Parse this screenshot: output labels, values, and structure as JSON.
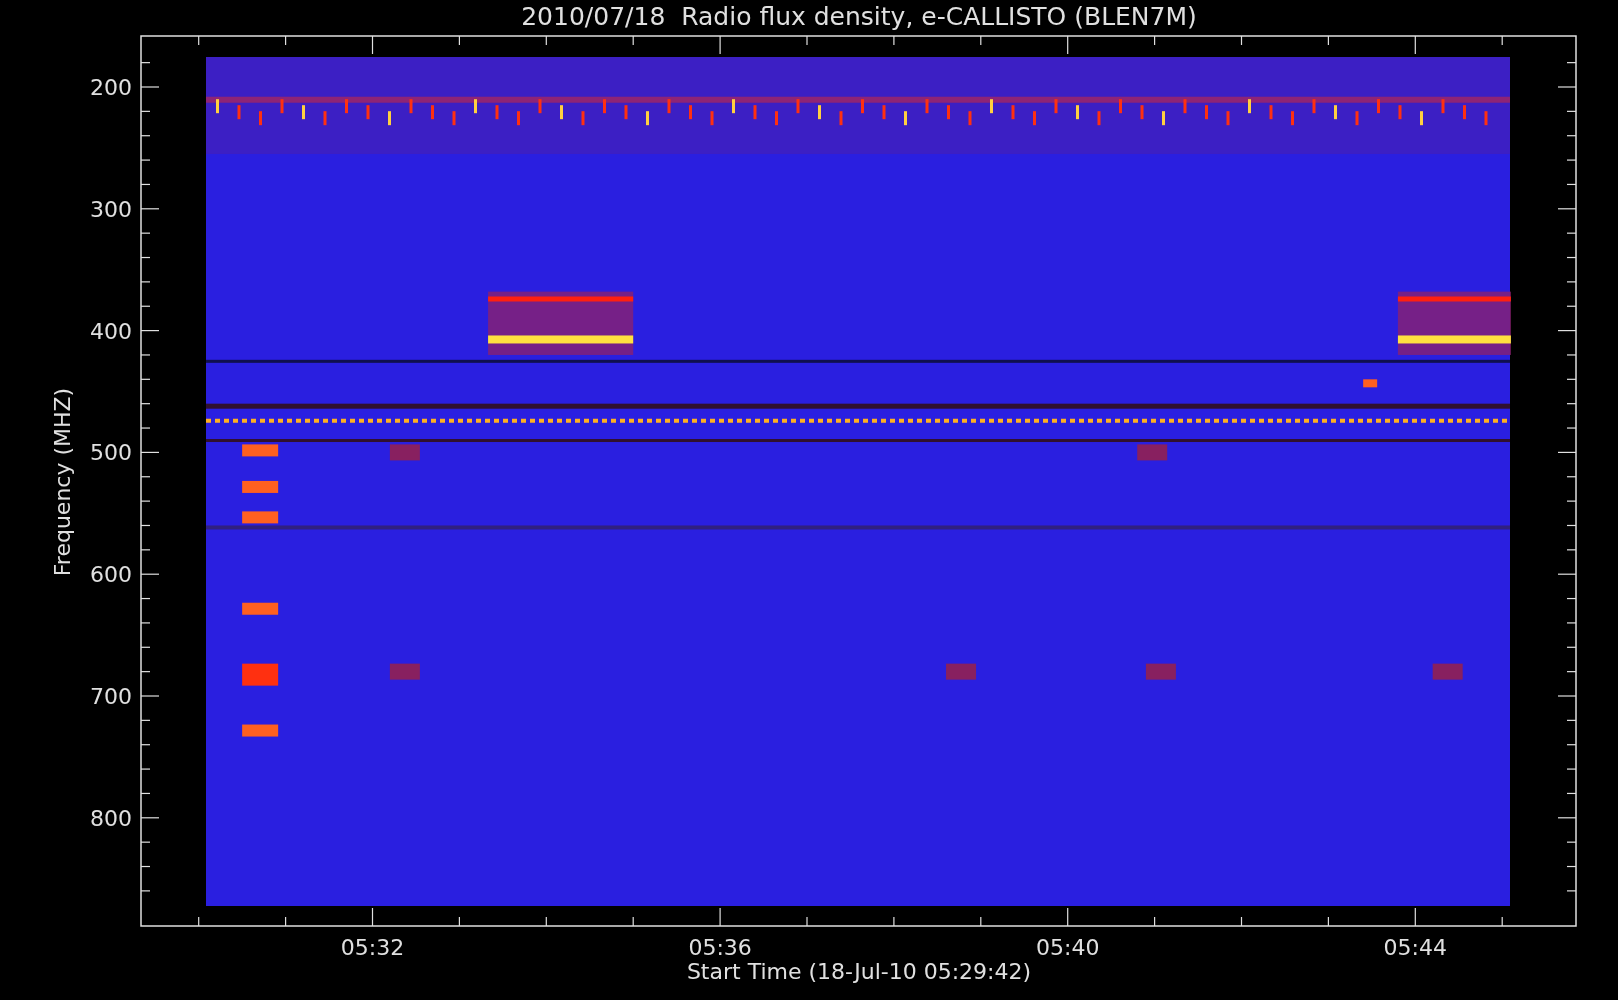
{
  "title": "2010/07/18  Radio flux density, e-CALLISTO (BLEN7M)",
  "y_axis": {
    "title": "Frequency (MHZ)",
    "ticks": [
      "200",
      "300",
      "400",
      "500",
      "600",
      "700",
      "800"
    ]
  },
  "x_axis": {
    "title": "Start Time (18-Jul-10 05:29:42)",
    "ticks": [
      "05:32",
      "05:36",
      "05:40",
      "05:44"
    ]
  }
}
